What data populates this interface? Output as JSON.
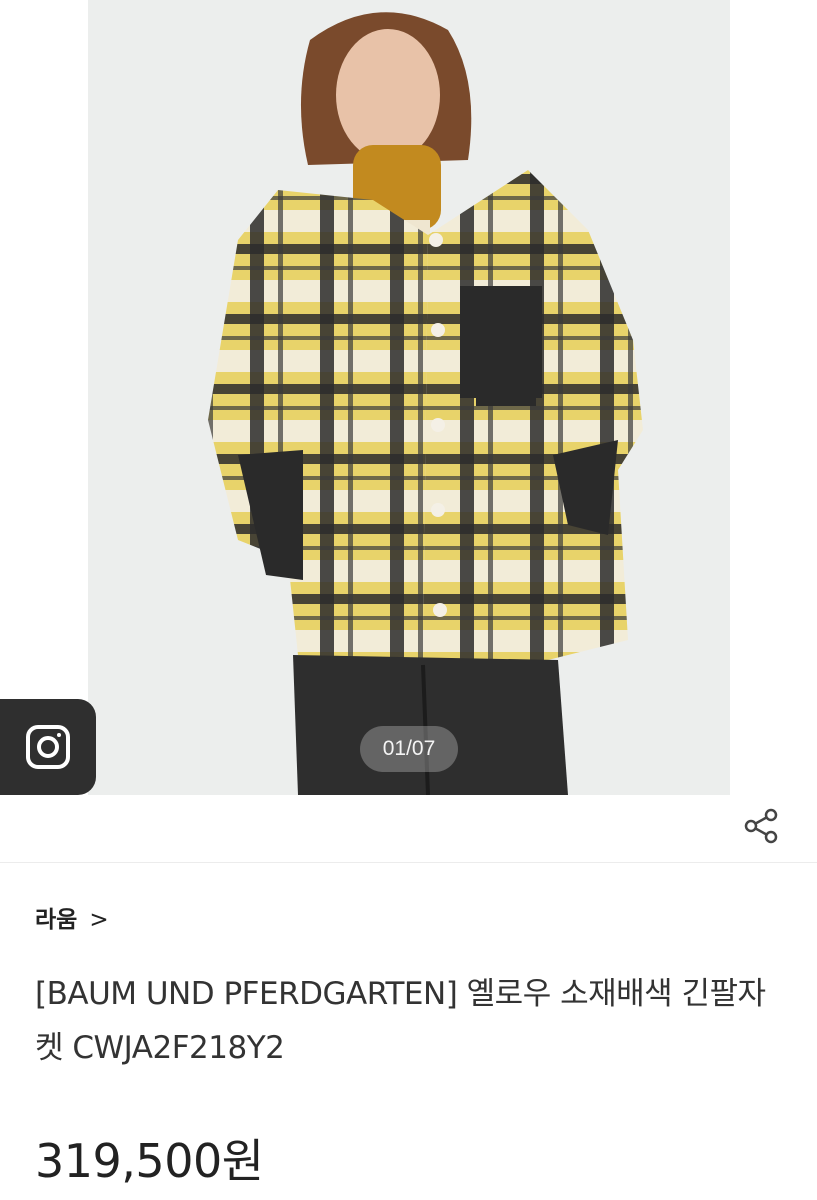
{
  "gallery": {
    "counter": "01/07"
  },
  "product": {
    "brand": "라움",
    "brand_chevron": ">",
    "title_line1": "[BAUM UND PFERDGARTEN] 옐로우 소재배색 긴팔자",
    "title_line2": "켓 CWJA2F218Y2",
    "price": "319,500원"
  },
  "icons": {
    "camera": "camera-icon",
    "share": "share-icon"
  }
}
